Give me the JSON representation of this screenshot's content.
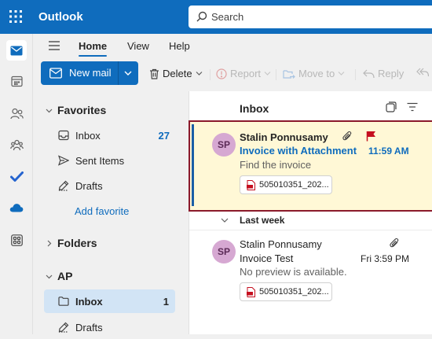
{
  "app": {
    "title": "Outlook"
  },
  "search": {
    "placeholder": "Search"
  },
  "ribbon": {
    "tabs": [
      "Home",
      "View",
      "Help"
    ],
    "new_mail": "New mail",
    "delete": "Delete",
    "report": "Report",
    "move_to": "Move to",
    "reply": "Reply"
  },
  "folders": {
    "favorites_label": "Favorites",
    "favorites": [
      {
        "label": "Inbox",
        "count": "27",
        "icon": "inbox-icon"
      },
      {
        "label": "Sent Items",
        "count": "",
        "icon": "send-icon"
      },
      {
        "label": "Drafts",
        "count": "",
        "icon": "drafts-icon"
      }
    ],
    "add_favorite": "Add favorite",
    "folders_label": "Folders",
    "account_label": "AP",
    "account_items": [
      {
        "label": "Inbox",
        "count": "1",
        "icon": "folder-icon"
      },
      {
        "label": "Drafts",
        "count": "",
        "icon": "drafts-icon"
      }
    ]
  },
  "message_list": {
    "title": "Inbox",
    "group_label": "Last week",
    "messages": [
      {
        "avatar": "SP",
        "sender": "Stalin Ponnusamy",
        "subject": "Invoice with Attachment",
        "time": "11:59 AM",
        "preview": "Find the invoice",
        "attachment": "505010351_202...",
        "flagged": true,
        "unread": true
      },
      {
        "avatar": "SP",
        "sender": "Stalin Ponnusamy",
        "subject": "Invoice Test",
        "time": "Fri 3:59 PM",
        "preview": "No preview is available.",
        "attachment": "505010351_202...",
        "flagged": false,
        "unread": false
      }
    ]
  },
  "colors": {
    "brand": "#0f6cbd",
    "selected_message_bg": "#fff8d6",
    "highlight_border": "#8b1a2b",
    "flag": "#c50f1f"
  }
}
